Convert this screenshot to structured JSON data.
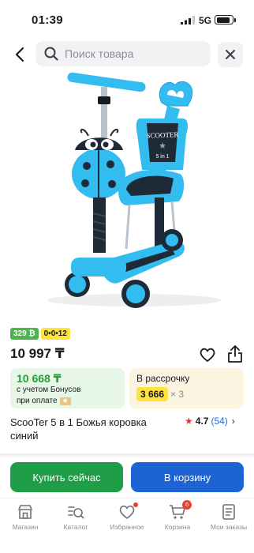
{
  "status_bar": {
    "time": "01:39",
    "network": "5G"
  },
  "search": {
    "placeholder": "Поиск товара"
  },
  "badges": {
    "green": "329 ₿",
    "yellow": "0•0•12"
  },
  "price": {
    "main": "10 997 ₸"
  },
  "bonus_card": {
    "price": "10 668 ₸",
    "line1": "с учетом Бонусов",
    "line2": "при оплате",
    "coin_icon": "bonus-coin-icon"
  },
  "installment": {
    "title": "В рассрочку",
    "amount": "3 666",
    "multiplier": "× 3"
  },
  "product": {
    "title": "ScooTer 5 в 1 Божья коровка синий"
  },
  "rating": {
    "value": "4.7",
    "count": "(54)",
    "chevron": "›",
    "star": "★"
  },
  "buttons": {
    "buy_now": "Купить сейчас",
    "add_to_cart": "В корзину"
  },
  "nav": [
    {
      "label": "Магазин",
      "icon": "shop-icon"
    },
    {
      "label": "Каталог",
      "icon": "catalog-search-icon"
    },
    {
      "label": "Избранное",
      "icon": "heart-icon",
      "dot": true
    },
    {
      "label": "Корзина",
      "icon": "cart-icon",
      "count": "6"
    },
    {
      "label": "Мои заказы",
      "icon": "orders-icon"
    }
  ],
  "colors": {
    "accent_green": "#1f9e47",
    "accent_blue": "#1d63d3",
    "badge_red": "#ef3b35",
    "bonus_green": "#2a9b3a",
    "highlight_yellow": "#ffe23d"
  },
  "image_text": {
    "seat_logo_line1": "SCOOTER",
    "seat_logo_line2": "5 in 1"
  }
}
